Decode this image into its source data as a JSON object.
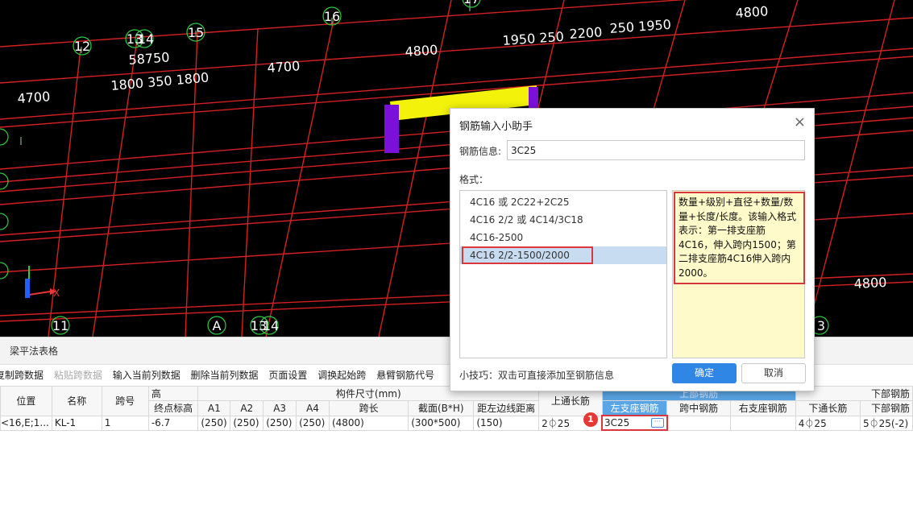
{
  "viewport": {
    "axis_labels": [
      "12",
      "13",
      "14",
      "15",
      "16",
      "17",
      "11",
      "A",
      "13",
      "14",
      "3"
    ],
    "dimensions": [
      "4700",
      "58750",
      "1800 350 1800",
      "4700",
      "4800",
      "1950 250",
      "2200",
      "250 1950",
      "4800",
      "4800"
    ],
    "coord_x_label": "X",
    "colors": {
      "grid": "#d42020",
      "beam": "#f2f20a",
      "column": "#7b10d8",
      "axis_circle": "#2ecc40"
    }
  },
  "panel": {
    "title": "梁平法表格",
    "toolbar": {
      "copy_span": "复制跨数据",
      "paste_span": "粘贴跨数据",
      "input_col": "输入当前列数据",
      "delete_col": "删除当前列数据",
      "page_setup": "页面设置",
      "swap_start": "调换起始跨",
      "cantilever": "悬臂钢筋代号"
    },
    "group_headers": {
      "elev": "高",
      "size": "构件尺寸(mm)",
      "top_rebar": "上部钢筋",
      "bottom_rebar": "下部钢筋"
    },
    "columns": {
      "position": "位置",
      "name": "名称",
      "span_no": "跨号",
      "end_elev": "终点标高",
      "a1": "A1",
      "a2": "A2",
      "a3": "A3",
      "a4": "A4",
      "span_len": "跨长",
      "section": "截面(B*H)",
      "edge_dist": "距左边线距离",
      "top_through": "上通长筋",
      "left_support": "左支座钢筋",
      "mid_span": "跨中钢筋",
      "right_support": "右支座钢筋",
      "bottom_through": "下通长筋",
      "bottom_rebar_col": "下部钢筋"
    },
    "row": {
      "position": "<16,E;1...",
      "name": "KL-1",
      "span_no": "1",
      "end_elev": "-6.7",
      "a1": "(250)",
      "a2": "(250)",
      "a3": "(250)",
      "a4": "(250)",
      "span_len": "(4800)",
      "section": "(300*500)",
      "edge_dist": "(150)",
      "top_through": "2⏀25",
      "left_support": "3C25",
      "mid_span": "",
      "right_support": "",
      "bottom_through": "4⏀25",
      "bottom_rebar": "5⏀25(-2)"
    },
    "ellipsis": "···",
    "step_badge": "1"
  },
  "dialog": {
    "title": "钢筋输入小助手",
    "close": "×",
    "info_label": "钢筋信息:",
    "info_value": "3C25",
    "format_label": "格式：",
    "formats": [
      "4C16 或 2C22+2C25",
      "4C16 2/2 或 4C14/3C18",
      "4C16-2500",
      "4C16 2/2-1500/2000"
    ],
    "selected_format": 3,
    "description": "数量+级别+直径+数量/数量+长度/长度。该输入格式表示：第一排支座筋4C16，伸入跨内1500；第二排支座筋4C16伸入跨内2000。",
    "tip": "小技巧：双击可直接添加至钢筋信息",
    "ok": "确定",
    "cancel": "取消"
  }
}
